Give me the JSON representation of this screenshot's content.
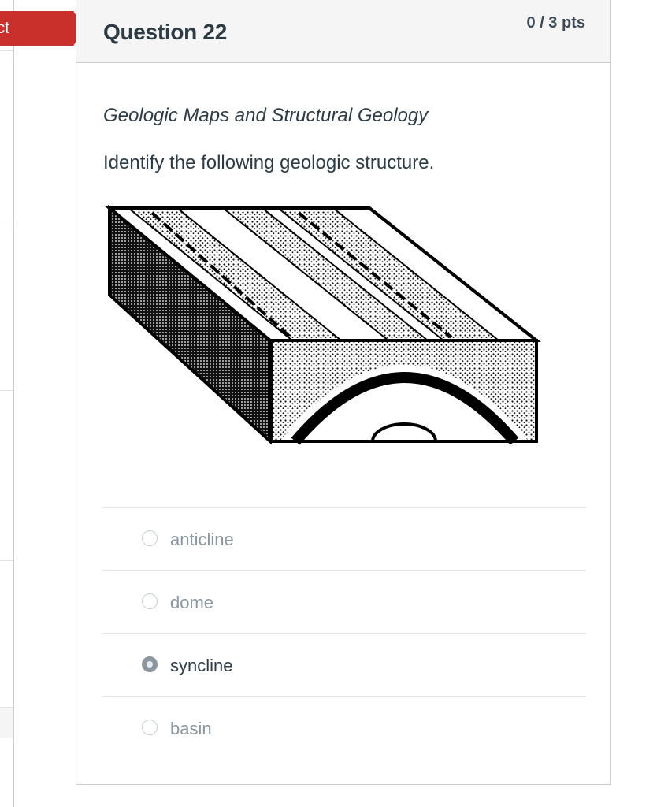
{
  "status_badge": {
    "label": "rrect",
    "color": "#c9302c"
  },
  "question": {
    "title": "Question 22",
    "points": "0 / 3 pts",
    "subtitle": "Geologic Maps and Structural Geology",
    "prompt": "Identify the following geologic structure."
  },
  "figure": {
    "icon": "anticline-block-diagram"
  },
  "answers": [
    {
      "label": "anticline",
      "selected": false
    },
    {
      "label": "dome",
      "selected": false
    },
    {
      "label": "syncline",
      "selected": true
    },
    {
      "label": "basin",
      "selected": false
    }
  ],
  "colors": {
    "selected_radio": "#8b969e",
    "text": "#2d3b45",
    "muted_text": "#8b969e"
  }
}
